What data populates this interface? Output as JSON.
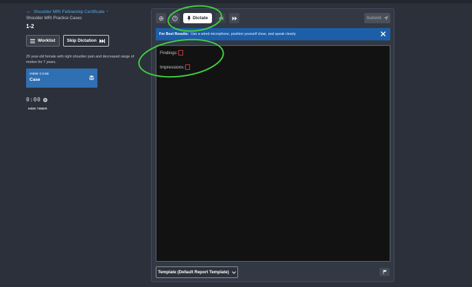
{
  "breadcrumb": {
    "back_label": "Shoulder MRI Fellowship Certificate"
  },
  "subtitle": "Shoulder MRI Practice Cases",
  "case_id": "1-2",
  "buttons": {
    "worklist": "Worklist",
    "skip_dictation": "Skip Dictation"
  },
  "case_description": "25 year-old female with right shoulder pain and decreased range of motion for 7 years.",
  "view_case": {
    "label": "VIEW CASE",
    "name": "Case"
  },
  "timer": {
    "value": "0:00",
    "hide_label": "HIDE TIMER"
  },
  "toolbar": {
    "dictate_label": "Dictate",
    "submit_label": "Submit"
  },
  "banner": {
    "bold": "For Best Results:",
    "text": "Use a wired microphone, position yourself close, and speak clearly"
  },
  "editor": {
    "findings_label": "Findings:",
    "impressions_label": "Impressions:"
  },
  "template_select": {
    "value": "Template (Default Report Template)"
  },
  "icons": {
    "back": "arrow-left-icon",
    "worklist": "list-icon",
    "skip": "fast-forward-icon",
    "view_case": "stack-icon",
    "timer_toggle": "pause-icon",
    "settings": "gear-icon",
    "help": "question-circle-icon",
    "mic": "microphone-icon",
    "rewind": "rewind-icon",
    "forward": "fast-forward-icon",
    "submit": "send-icon",
    "close": "close-icon",
    "chevron": "chevron-down-icon",
    "flag": "flag-icon"
  },
  "colors": {
    "background": "#2b303a",
    "panel": "#323844",
    "link": "#5aa9e6",
    "view_case_bg": "#2f6fb3",
    "banner_bg": "#1d5ea8",
    "editor_bg": "#121212",
    "placeholder_bracket": "#c23a3a",
    "annotation": "#3fcf3f"
  }
}
